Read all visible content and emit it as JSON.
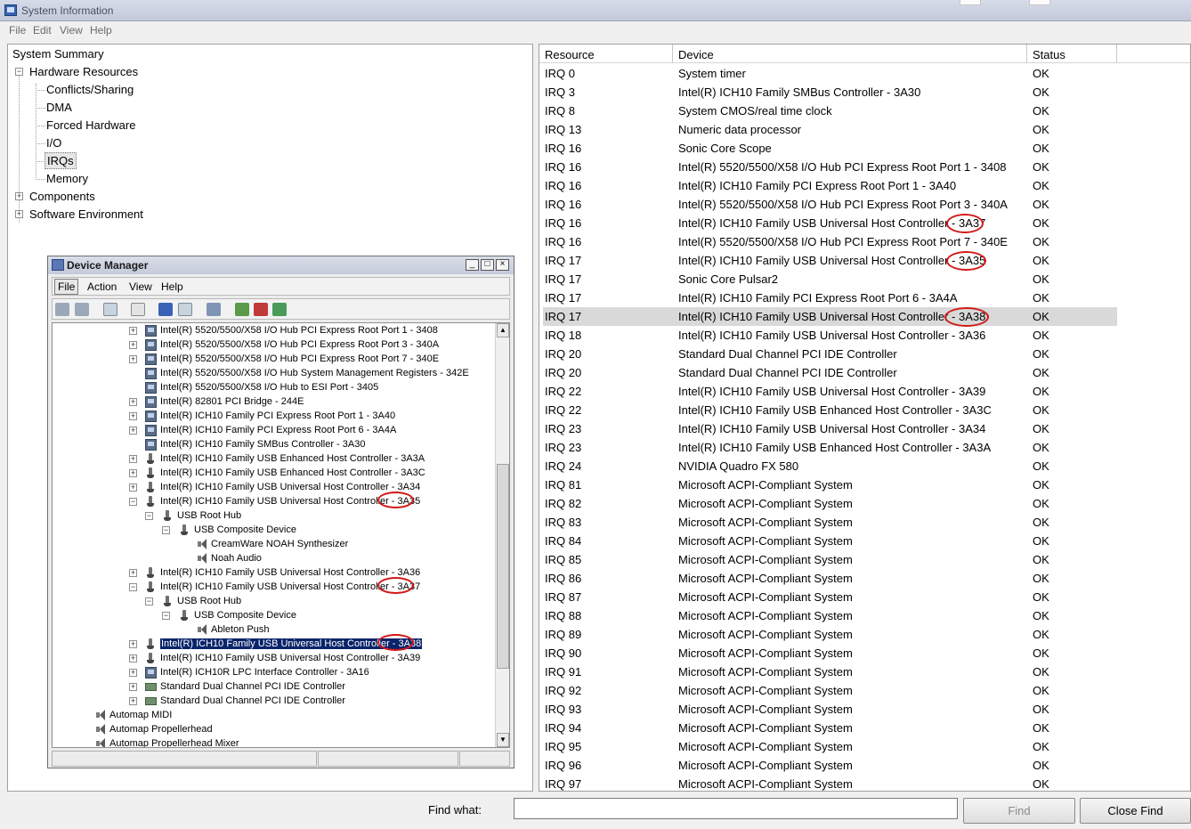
{
  "window": {
    "title": "System Information"
  },
  "menu": [
    "File",
    "Edit",
    "View",
    "Help"
  ],
  "tree": {
    "root": "System Summary",
    "hardware": "Hardware Resources",
    "children": [
      "Conflicts/Sharing",
      "DMA",
      "Forced Hardware",
      "I/O",
      "IRQs",
      "Memory"
    ],
    "selected": "IRQs",
    "components": "Components",
    "software": "Software Environment"
  },
  "table": {
    "headers": [
      "Resource",
      "Device",
      "Status"
    ],
    "rows": [
      [
        "IRQ 0",
        "System timer",
        "OK"
      ],
      [
        "IRQ 3",
        "Intel(R) ICH10 Family SMBus Controller - 3A30",
        "OK"
      ],
      [
        "IRQ 8",
        "System CMOS/real time clock",
        "OK"
      ],
      [
        "IRQ 13",
        "Numeric data processor",
        "OK"
      ],
      [
        "IRQ 16",
        "Sonic Core Scope",
        "OK"
      ],
      [
        "IRQ 16",
        "Intel(R) 5520/5500/X58 I/O Hub PCI Express Root Port 1 - 3408",
        "OK"
      ],
      [
        "IRQ 16",
        "Intel(R) ICH10 Family PCI Express Root Port 1 - 3A40",
        "OK"
      ],
      [
        "IRQ 16",
        "Intel(R) 5520/5500/X58 I/O Hub PCI Express Root Port 3 - 340A",
        "OK"
      ],
      [
        "IRQ 16",
        "Intel(R) ICH10 Family USB Universal Host Controller - 3A37",
        "OK"
      ],
      [
        "IRQ 16",
        "Intel(R) 5520/5500/X58 I/O Hub PCI Express Root Port 7 - 340E",
        "OK"
      ],
      [
        "IRQ 17",
        "Intel(R) ICH10 Family USB Universal Host Controller - 3A35",
        "OK"
      ],
      [
        "IRQ 17",
        "Sonic Core Pulsar2",
        "OK"
      ],
      [
        "IRQ 17",
        "Intel(R) ICH10 Family PCI Express Root Port 6 - 3A4A",
        "OK"
      ],
      [
        "IRQ 17",
        "Intel(R) ICH10 Family USB Universal Host Controller - 3A38",
        "OK"
      ],
      [
        "IRQ 18",
        "Intel(R) ICH10 Family USB Universal Host Controller - 3A36",
        "OK"
      ],
      [
        "IRQ 20",
        "Standard Dual Channel PCI IDE Controller",
        "OK"
      ],
      [
        "IRQ 20",
        "Standard Dual Channel PCI IDE Controller",
        "OK"
      ],
      [
        "IRQ 22",
        "Intel(R) ICH10 Family USB Universal Host Controller - 3A39",
        "OK"
      ],
      [
        "IRQ 22",
        "Intel(R) ICH10 Family USB Enhanced Host Controller - 3A3C",
        "OK"
      ],
      [
        "IRQ 23",
        "Intel(R) ICH10 Family USB Universal Host Controller - 3A34",
        "OK"
      ],
      [
        "IRQ 23",
        "Intel(R) ICH10 Family USB Enhanced Host Controller - 3A3A",
        "OK"
      ],
      [
        "IRQ 24",
        "NVIDIA Quadro FX 580",
        "OK"
      ],
      [
        "IRQ 81",
        "Microsoft ACPI-Compliant System",
        "OK"
      ],
      [
        "IRQ 82",
        "Microsoft ACPI-Compliant System",
        "OK"
      ],
      [
        "IRQ 83",
        "Microsoft ACPI-Compliant System",
        "OK"
      ],
      [
        "IRQ 84",
        "Microsoft ACPI-Compliant System",
        "OK"
      ],
      [
        "IRQ 85",
        "Microsoft ACPI-Compliant System",
        "OK"
      ],
      [
        "IRQ 86",
        "Microsoft ACPI-Compliant System",
        "OK"
      ],
      [
        "IRQ 87",
        "Microsoft ACPI-Compliant System",
        "OK"
      ],
      [
        "IRQ 88",
        "Microsoft ACPI-Compliant System",
        "OK"
      ],
      [
        "IRQ 89",
        "Microsoft ACPI-Compliant System",
        "OK"
      ],
      [
        "IRQ 90",
        "Microsoft ACPI-Compliant System",
        "OK"
      ],
      [
        "IRQ 91",
        "Microsoft ACPI-Compliant System",
        "OK"
      ],
      [
        "IRQ 92",
        "Microsoft ACPI-Compliant System",
        "OK"
      ],
      [
        "IRQ 93",
        "Microsoft ACPI-Compliant System",
        "OK"
      ],
      [
        "IRQ 94",
        "Microsoft ACPI-Compliant System",
        "OK"
      ],
      [
        "IRQ 95",
        "Microsoft ACPI-Compliant System",
        "OK"
      ],
      [
        "IRQ 96",
        "Microsoft ACPI-Compliant System",
        "OK"
      ],
      [
        "IRQ 97",
        "Microsoft ACPI-Compliant System",
        "OK"
      ]
    ],
    "selected_row": 13
  },
  "find": {
    "label": "Find what:",
    "value": "",
    "find_button": "Find",
    "close_button": "Close Find"
  },
  "device_manager": {
    "title": "Device Manager",
    "menu": [
      "File",
      "Action",
      "View",
      "Help"
    ],
    "items": [
      "Intel(R) 5520/5500/X58 I/O Hub PCI Express Root Port 1 - 3408",
      "Intel(R) 5520/5500/X58 I/O Hub PCI Express Root Port 3 - 340A",
      "Intel(R) 5520/5500/X58 I/O Hub PCI Express Root Port 7 - 340E",
      "Intel(R) 5520/5500/X58 I/O Hub System Management Registers - 342E",
      "Intel(R) 5520/5500/X58 I/O Hub to ESI Port - 3405",
      "Intel(R) 82801 PCI Bridge - 244E",
      "Intel(R) ICH10 Family PCI Express Root Port 1 - 3A40",
      "Intel(R) ICH10 Family PCI Express Root Port 6 - 3A4A",
      "Intel(R) ICH10 Family SMBus Controller - 3A30",
      "Intel(R) ICH10 Family USB Enhanced Host Controller - 3A3A",
      "Intel(R) ICH10 Family USB Enhanced Host Controller - 3A3C",
      "Intel(R) ICH10 Family USB Universal Host Controller - 3A34",
      "Intel(R) ICH10 Family USB Universal Host Controller - 3A35",
      "USB Root Hub",
      "USB Composite Device",
      "CreamWare NOAH Synthesizer",
      "Noah Audio",
      "Intel(R) ICH10 Family USB Universal Host Controller - 3A36",
      "Intel(R) ICH10 Family USB Universal Host Controller - 3A37",
      "USB Root Hub",
      "USB Composite Device",
      "Ableton Push",
      "Intel(R) ICH10 Family USB Universal Host Controller - 3A38",
      "Intel(R) ICH10 Family USB Universal Host Controller - 3A39",
      "Intel(R) ICH10R LPC Interface Controller - 3A16",
      "Standard Dual Channel PCI IDE Controller",
      "Standard Dual Channel PCI IDE Controller",
      "Automap MIDI",
      "Automap Propellerhead",
      "Automap Propellerhead Mixer"
    ],
    "selected_index": 22
  },
  "colors": {
    "highlight_oval": "#d21919",
    "selection": "#0a246a",
    "row_selected": "#d9d9d9"
  }
}
